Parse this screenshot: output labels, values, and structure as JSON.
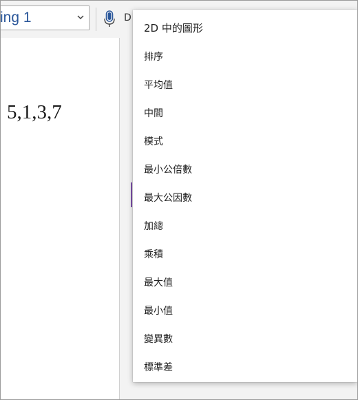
{
  "ribbon": {
    "style_value": "ing 1",
    "dictate_label_partial": "D"
  },
  "document": {
    "text": "5,1,3,7"
  },
  "menu": {
    "items": [
      {
        "label": "2D 中的圖形"
      },
      {
        "label": "排序"
      },
      {
        "label": "平均值"
      },
      {
        "label": "中間"
      },
      {
        "label": "模式"
      },
      {
        "label": "最小公倍數"
      },
      {
        "label": "最大公因數"
      },
      {
        "label": "加總"
      },
      {
        "label": "乘積"
      },
      {
        "label": "最大值"
      },
      {
        "label": "最小值"
      },
      {
        "label": "變異數"
      },
      {
        "label": "標準差"
      }
    ]
  },
  "colors": {
    "style_text": "#2b579a",
    "mic": "#2b579a",
    "purple_mark": "#7b4fa8",
    "ribbon_bg": "#f3f3f3"
  },
  "icons": {
    "chevron": "chevron-down-icon",
    "microphone": "microphone-icon"
  }
}
